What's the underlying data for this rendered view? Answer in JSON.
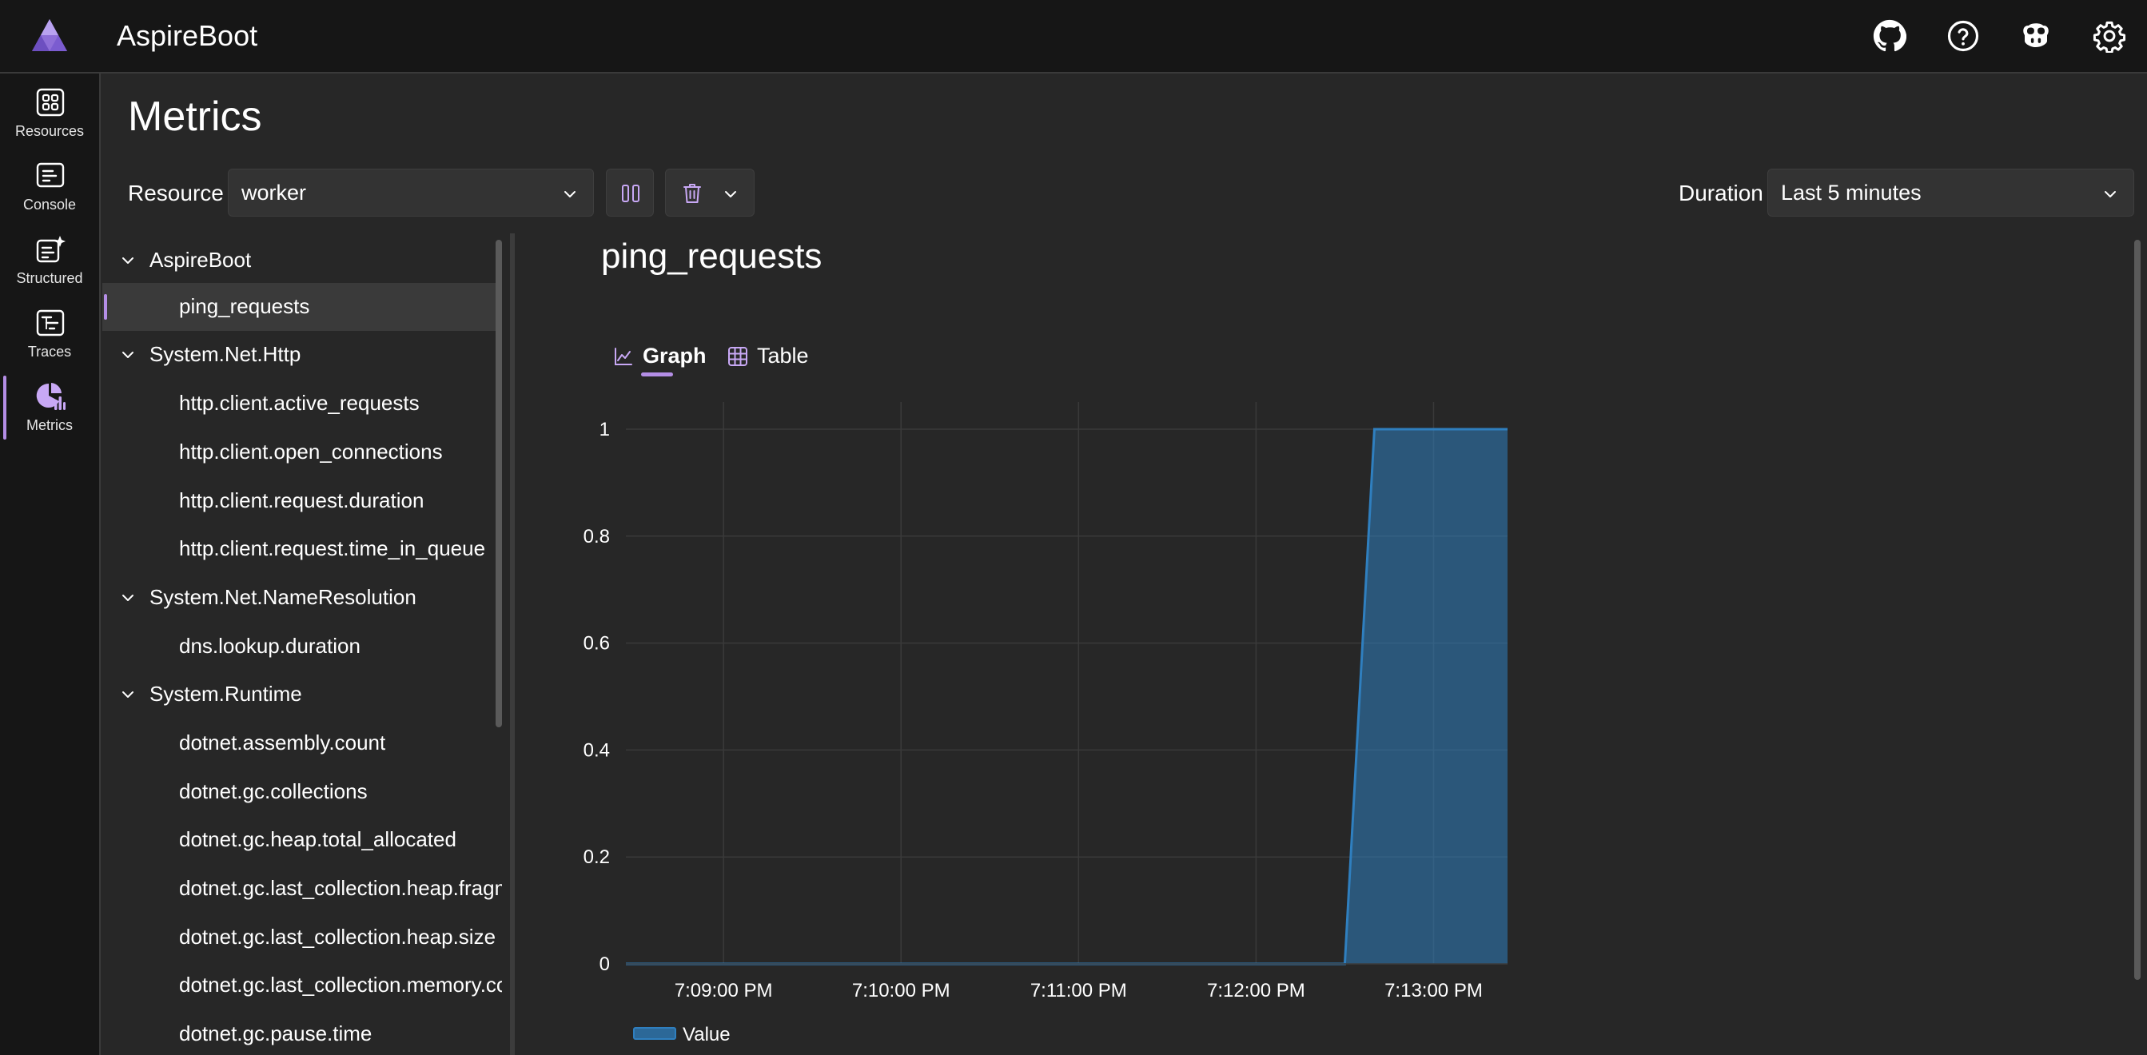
{
  "app": {
    "title": "AspireBoot"
  },
  "header_icons": [
    "github-icon",
    "help-icon",
    "copilot-icon",
    "settings-icon"
  ],
  "nav": {
    "items": [
      {
        "label": "Resources",
        "icon": "resources-icon"
      },
      {
        "label": "Console",
        "icon": "console-icon"
      },
      {
        "label": "Structured",
        "icon": "structured-icon"
      },
      {
        "label": "Traces",
        "icon": "traces-icon"
      },
      {
        "label": "Metrics",
        "icon": "metrics-icon",
        "active": true
      }
    ]
  },
  "page": {
    "title": "Metrics",
    "resource_label": "Resource",
    "resource_value": "worker",
    "duration_label": "Duration",
    "duration_value": "Last 5 minutes"
  },
  "tree": {
    "groups": [
      {
        "name": "AspireBoot",
        "items": [
          "ping_requests"
        ]
      },
      {
        "name": "System.Net.Http",
        "items": [
          "http.client.active_requests",
          "http.client.open_connections",
          "http.client.request.duration",
          "http.client.request.time_in_queue"
        ]
      },
      {
        "name": "System.Net.NameResolution",
        "items": [
          "dns.lookup.duration"
        ]
      },
      {
        "name": "System.Runtime",
        "items": [
          "dotnet.assembly.count",
          "dotnet.gc.collections",
          "dotnet.gc.heap.total_allocated",
          "dotnet.gc.last_collection.heap.fragm",
          "dotnet.gc.last_collection.heap.size",
          "dotnet.gc.last_collection.memory.co",
          "dotnet.gc.pause.time"
        ]
      }
    ],
    "selected": "ping_requests"
  },
  "metric": {
    "title": "ping_requests",
    "tabs": [
      {
        "label": "Graph",
        "active": true
      },
      {
        "label": "Table",
        "active": false
      }
    ]
  },
  "chart_data": {
    "type": "area",
    "title": "",
    "xlabel": "",
    "ylabel": "",
    "ylim": [
      0,
      1
    ],
    "yticks": [
      "0",
      "0.2",
      "0.4",
      "0.6",
      "0.8",
      "1"
    ],
    "xticks": [
      "7:09:00 PM",
      "7:10:00 PM",
      "7:11:00 PM",
      "7:12:00 PM",
      "7:13:00 PM"
    ],
    "x": [
      "7:08:27 PM",
      "7:12:30 PM",
      "7:12:40 PM",
      "7:13:25 PM"
    ],
    "series": [
      {
        "name": "Value",
        "values": [
          0,
          0,
          1,
          1
        ],
        "color": "#2f7fbf"
      }
    ],
    "grid": true,
    "legend": "bottom-left"
  }
}
